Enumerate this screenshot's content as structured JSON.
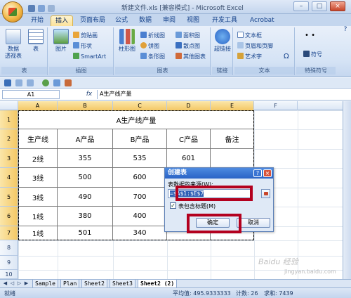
{
  "window": {
    "title": "新建文件.xls [兼容模式] - Microsoft Excel",
    "min": "–",
    "max": "□",
    "close": "×"
  },
  "tabs": [
    "开始",
    "插入",
    "页面布局",
    "公式",
    "数据",
    "审阅",
    "视图",
    "开发工具",
    "Acrobat"
  ],
  "active_tab": "插入",
  "ribbon": {
    "groups": {
      "table": {
        "label": "表",
        "pivot": "数据\n透视表",
        "table": "表"
      },
      "illustrations": {
        "label": "插图",
        "picture": "图片",
        "clipart": "剪贴画",
        "shapes": "形状",
        "smartart": "SmartArt"
      },
      "charts": {
        "label": "图表",
        "column": "柱形图",
        "line": "折线图",
        "pie": "饼图",
        "bar": "条形图",
        "area": "面积图",
        "scatter": "散点图",
        "other": "其他图表"
      },
      "links": {
        "label": "链接",
        "hyperlink": "超链接"
      },
      "text": {
        "label": "文本",
        "textbox": "文本框",
        "header": "页眉和页脚",
        "wordart": "艺术字",
        "symbols_small": "Ω"
      },
      "special": {
        "label": "特殊符号",
        "symbol": "符号",
        "dots": "• •"
      }
    }
  },
  "formula_bar": {
    "name_box": "A1",
    "fx": "fx",
    "formula": "A生产线产量"
  },
  "columns": [
    "A",
    "B",
    "C",
    "D",
    "E",
    "F"
  ],
  "rows": [
    "1",
    "2",
    "3",
    "4",
    "5",
    "6",
    "7",
    "8",
    "9",
    "10"
  ],
  "table": {
    "title": "A生产线产量",
    "header": [
      "生产线",
      "A产品",
      "B产品",
      "C产品",
      "备注"
    ],
    "data": [
      [
        "2线",
        "355",
        "535",
        "601",
        ""
      ],
      [
        "3线",
        "500",
        "600",
        "",
        ""
      ],
      [
        "3线",
        "490",
        "700",
        "",
        ""
      ],
      [
        "1线",
        "380",
        "400",
        "",
        ""
      ],
      [
        "1线",
        "501",
        "340",
        "",
        ""
      ]
    ]
  },
  "dialog": {
    "title": "创建表",
    "help": "?",
    "close": "×",
    "prompt": "表数据的来源(W):",
    "range": "=$A$1:$E$7",
    "has_headers": "表包含标题(M)",
    "ok": "确定",
    "cancel": "取消"
  },
  "sheets": [
    "Sample",
    "Plan",
    "Sheet2",
    "Sheet3",
    "Sheet2 (2)"
  ],
  "active_sheet": "Sheet2 (2)",
  "status": {
    "mode": "就绪",
    "average": "平均值: 495.9333333",
    "count": "计数: 26",
    "sum": "求和: 7439"
  },
  "watermark": {
    "brand": "Baidu 经验",
    "url": "jingyan.baidu.com"
  },
  "colors": {
    "accent": "#b3001e",
    "ribbon": "#d5e3f5",
    "selection": "#f4c865"
  }
}
